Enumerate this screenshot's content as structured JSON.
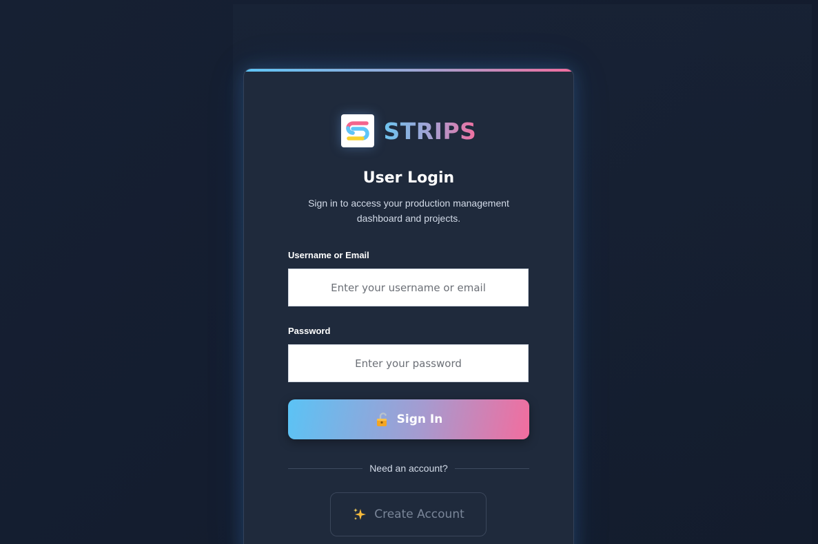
{
  "brand": {
    "name": "STRIPS",
    "logo_letter": "S"
  },
  "login": {
    "title": "User Login",
    "subtitle": "Sign in to access your production management dashboard and projects.",
    "username_label": "Username or Email",
    "username_placeholder": "Enter your username or email",
    "username_value": "",
    "password_label": "Password",
    "password_placeholder": "Enter your password",
    "password_value": "",
    "signin_label": "Sign In",
    "signin_icon": "unlock-icon",
    "divider_text": "Need an account?",
    "create_label": "Create Account",
    "create_icon": "sparkles-icon"
  },
  "colors": {
    "background": "#131c2d",
    "card": "#1f2a3c",
    "accent_blue": "#5bc3f5",
    "accent_pink": "#f26d9e"
  }
}
